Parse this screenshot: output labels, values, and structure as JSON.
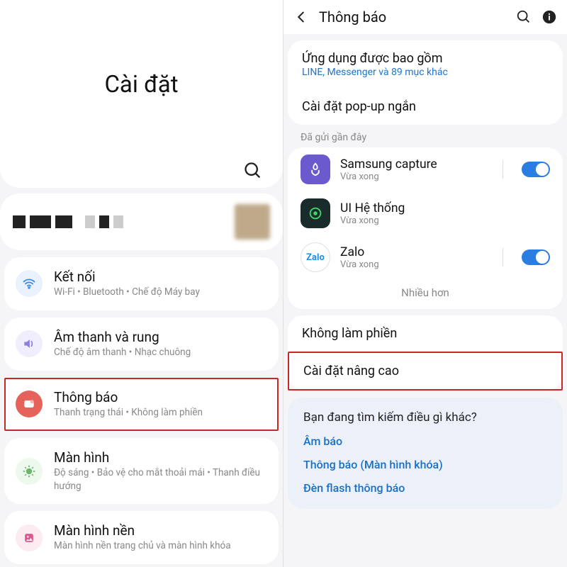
{
  "left": {
    "hero_title": "Cài đặt",
    "items": [
      {
        "title": "Kết nối",
        "sub": "Wi-Fi  •  Bluetooth  •  Chế độ Máy bay",
        "icon": "wifi",
        "bg": "#e8f1fc",
        "fg": "#3b8ae6"
      },
      {
        "title": "Âm thanh và rung",
        "sub": "Chế độ âm thanh  •  Nhạc chuông",
        "icon": "sound",
        "bg": "#f0eefc",
        "fg": "#8d7ce0"
      },
      {
        "title": "Thông báo",
        "sub": "Thanh trạng thái  •  Không làm phiền",
        "icon": "notif",
        "bg": "#fdeceb",
        "fg": "#e5635a",
        "highlight": true
      },
      {
        "title": "Màn hình",
        "sub": "Độ sáng  •  Bảo vệ cho mắt thoải mái  •  Thanh điều hướng",
        "icon": "display",
        "bg": "#eef9ee",
        "fg": "#6cb36c"
      },
      {
        "title": "Màn hình nền",
        "sub": "Màn hình nền trang chủ và màn hình khóa",
        "icon": "wall",
        "bg": "#fcecf2",
        "fg": "#d95a8e"
      }
    ]
  },
  "right": {
    "header_title": "Thông báo",
    "sect1": {
      "row1_title": "Ứng dụng được bao gồm",
      "row1_sub": "LINE, Messenger và 89 mục khác",
      "row2_title": "Cài đặt pop-up ngắn"
    },
    "recent_label": "Đã gửi gần đây",
    "apps": [
      {
        "name": "Samsung capture",
        "sub": "Vừa xong",
        "bg": "#6a5acd",
        "label": "",
        "toggle": true
      },
      {
        "name": "UI Hệ thống",
        "sub": "Vừa xong",
        "bg": "#1a2b2b",
        "label": "",
        "toggle": false
      },
      {
        "name": "Zalo",
        "sub": "Vừa xong",
        "bg": "#ffffff",
        "label": "Zalo",
        "toggle": true
      }
    ],
    "more": "Nhiều hơn",
    "sect3": {
      "row1_title": "Không làm phiền",
      "row2_title": "Cài đặt nâng cao"
    },
    "footer": {
      "title": "Bạn đang tìm kiếm điều gì khác?",
      "links": [
        "Âm báo",
        "Thông báo (Màn hình khóa)",
        "Đèn flash thông báo"
      ]
    }
  }
}
